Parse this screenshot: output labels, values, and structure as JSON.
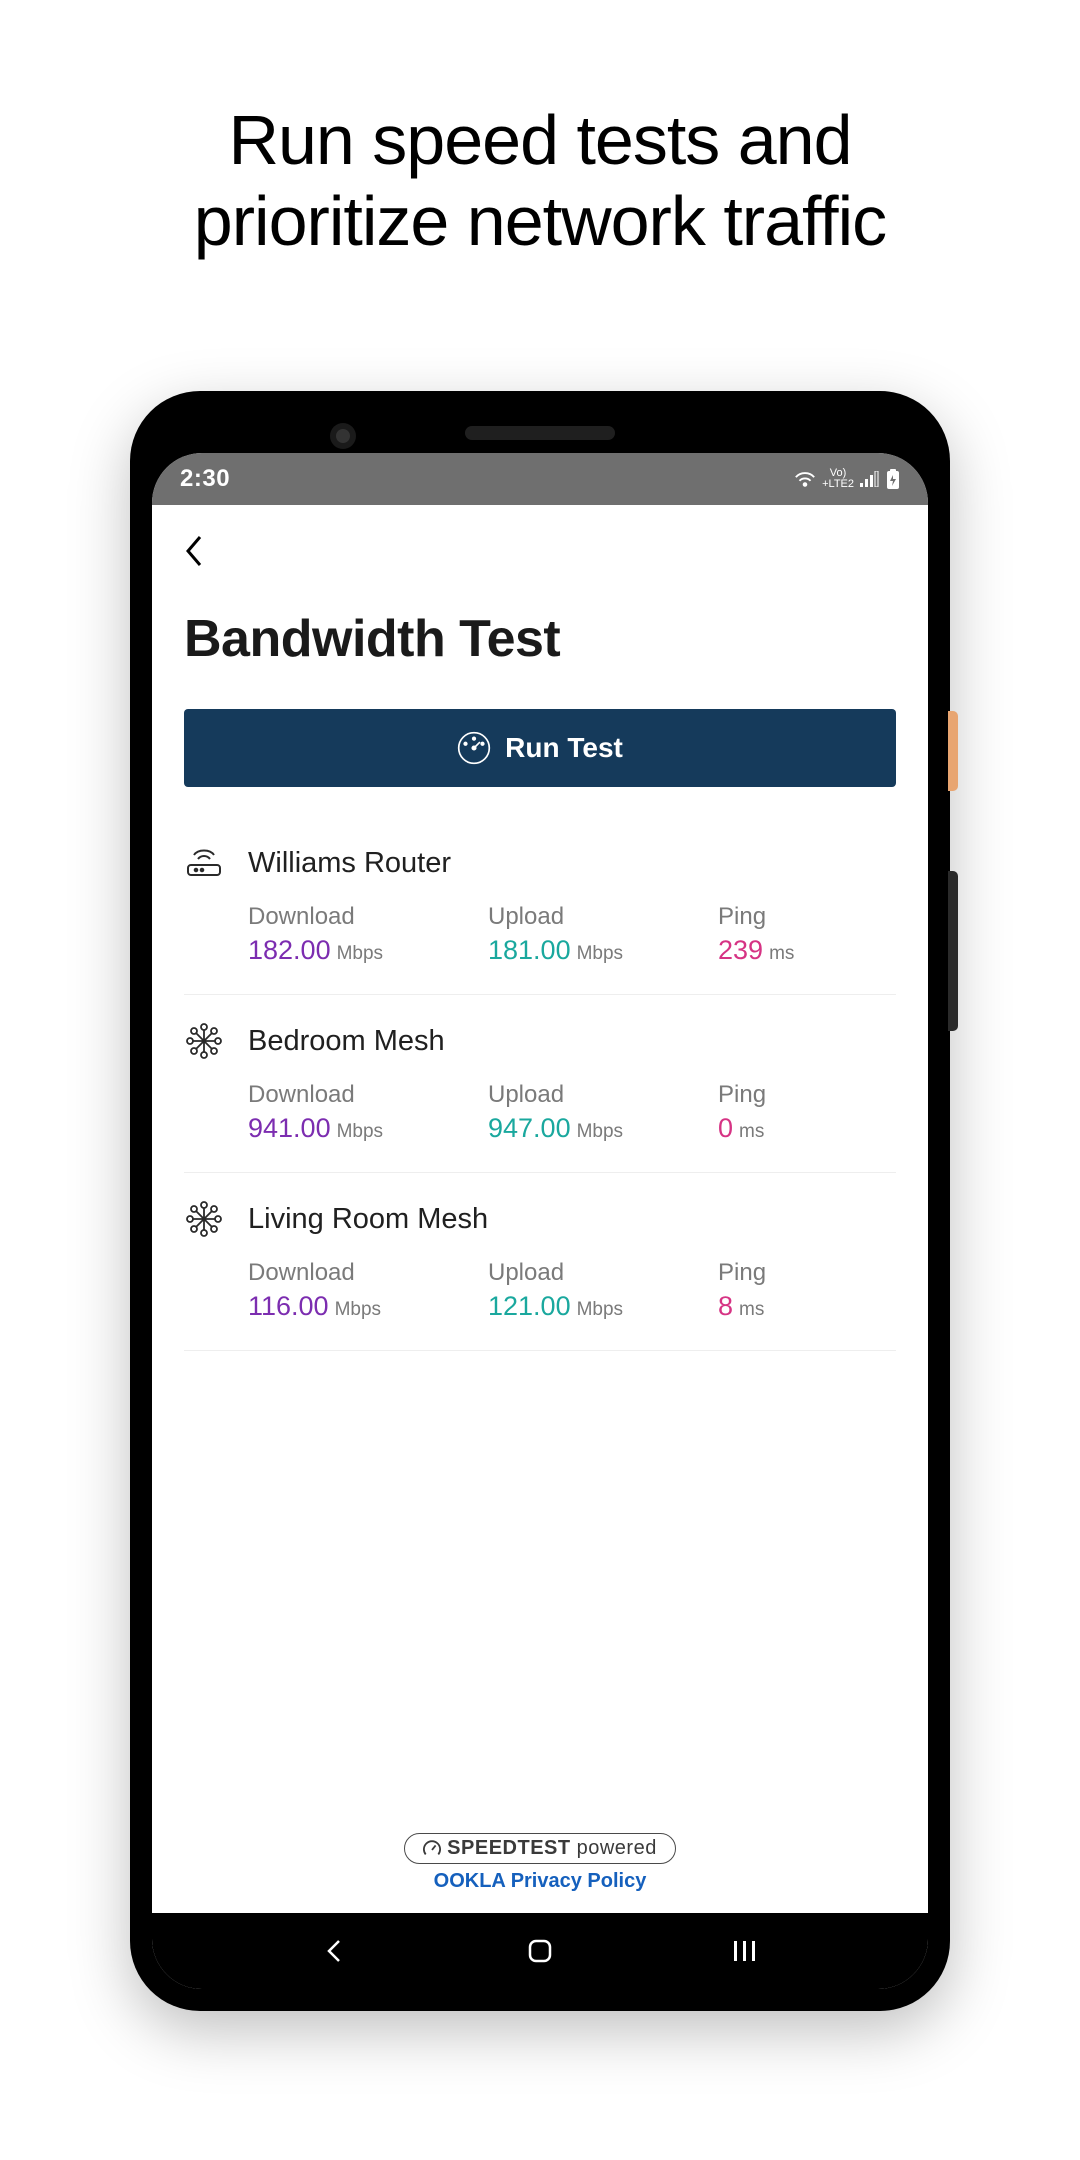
{
  "marketing": {
    "line1": "Run speed tests and",
    "line2": "prioritize network traffic"
  },
  "status": {
    "time": "2:30",
    "network": "LTE2",
    "volte": "Vo)"
  },
  "app": {
    "title": "Bandwidth Test",
    "run_test_label": "Run Test",
    "labels": {
      "download": "Download",
      "upload": "Upload",
      "ping": "Ping",
      "mbps": "Mbps",
      "ms": "ms"
    },
    "devices": [
      {
        "name": "Williams Router",
        "icon": "router",
        "download": "182.00",
        "upload": "181.00",
        "ping": "239"
      },
      {
        "name": "Bedroom Mesh",
        "icon": "mesh",
        "download": "941.00",
        "upload": "947.00",
        "ping": "0"
      },
      {
        "name": "Living Room Mesh",
        "icon": "mesh",
        "download": "116.00",
        "upload": "121.00",
        "ping": "8"
      }
    ],
    "footer": {
      "badge_brand": "SPEEDTEST",
      "badge_powered": "powered",
      "privacy_link": "OOKLA Privacy Policy"
    }
  }
}
